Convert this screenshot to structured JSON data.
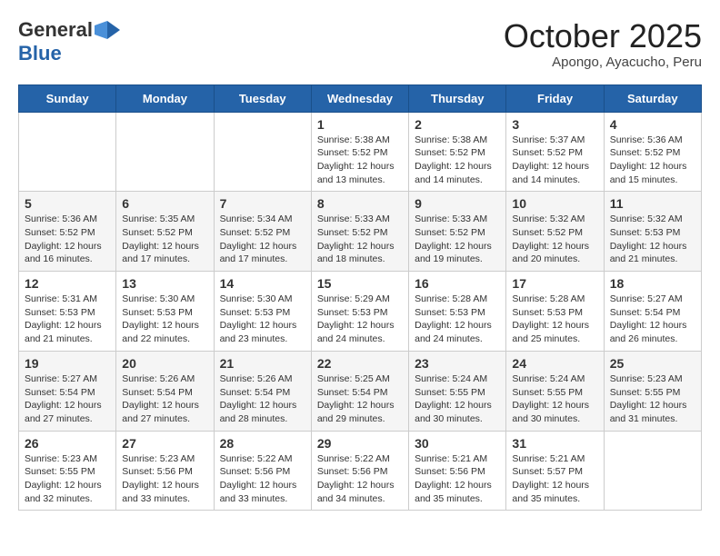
{
  "header": {
    "logo_general": "General",
    "logo_blue": "Blue",
    "month_title": "October 2025",
    "location": "Apongo, Ayacucho, Peru"
  },
  "weekdays": [
    "Sunday",
    "Monday",
    "Tuesday",
    "Wednesday",
    "Thursday",
    "Friday",
    "Saturday"
  ],
  "weeks": [
    [
      {
        "day": "",
        "info": ""
      },
      {
        "day": "",
        "info": ""
      },
      {
        "day": "",
        "info": ""
      },
      {
        "day": "1",
        "info": "Sunrise: 5:38 AM\nSunset: 5:52 PM\nDaylight: 12 hours\nand 13 minutes."
      },
      {
        "day": "2",
        "info": "Sunrise: 5:38 AM\nSunset: 5:52 PM\nDaylight: 12 hours\nand 14 minutes."
      },
      {
        "day": "3",
        "info": "Sunrise: 5:37 AM\nSunset: 5:52 PM\nDaylight: 12 hours\nand 14 minutes."
      },
      {
        "day": "4",
        "info": "Sunrise: 5:36 AM\nSunset: 5:52 PM\nDaylight: 12 hours\nand 15 minutes."
      }
    ],
    [
      {
        "day": "5",
        "info": "Sunrise: 5:36 AM\nSunset: 5:52 PM\nDaylight: 12 hours\nand 16 minutes."
      },
      {
        "day": "6",
        "info": "Sunrise: 5:35 AM\nSunset: 5:52 PM\nDaylight: 12 hours\nand 17 minutes."
      },
      {
        "day": "7",
        "info": "Sunrise: 5:34 AM\nSunset: 5:52 PM\nDaylight: 12 hours\nand 17 minutes."
      },
      {
        "day": "8",
        "info": "Sunrise: 5:33 AM\nSunset: 5:52 PM\nDaylight: 12 hours\nand 18 minutes."
      },
      {
        "day": "9",
        "info": "Sunrise: 5:33 AM\nSunset: 5:52 PM\nDaylight: 12 hours\nand 19 minutes."
      },
      {
        "day": "10",
        "info": "Sunrise: 5:32 AM\nSunset: 5:52 PM\nDaylight: 12 hours\nand 20 minutes."
      },
      {
        "day": "11",
        "info": "Sunrise: 5:32 AM\nSunset: 5:53 PM\nDaylight: 12 hours\nand 21 minutes."
      }
    ],
    [
      {
        "day": "12",
        "info": "Sunrise: 5:31 AM\nSunset: 5:53 PM\nDaylight: 12 hours\nand 21 minutes."
      },
      {
        "day": "13",
        "info": "Sunrise: 5:30 AM\nSunset: 5:53 PM\nDaylight: 12 hours\nand 22 minutes."
      },
      {
        "day": "14",
        "info": "Sunrise: 5:30 AM\nSunset: 5:53 PM\nDaylight: 12 hours\nand 23 minutes."
      },
      {
        "day": "15",
        "info": "Sunrise: 5:29 AM\nSunset: 5:53 PM\nDaylight: 12 hours\nand 24 minutes."
      },
      {
        "day": "16",
        "info": "Sunrise: 5:28 AM\nSunset: 5:53 PM\nDaylight: 12 hours\nand 24 minutes."
      },
      {
        "day": "17",
        "info": "Sunrise: 5:28 AM\nSunset: 5:53 PM\nDaylight: 12 hours\nand 25 minutes."
      },
      {
        "day": "18",
        "info": "Sunrise: 5:27 AM\nSunset: 5:54 PM\nDaylight: 12 hours\nand 26 minutes."
      }
    ],
    [
      {
        "day": "19",
        "info": "Sunrise: 5:27 AM\nSunset: 5:54 PM\nDaylight: 12 hours\nand 27 minutes."
      },
      {
        "day": "20",
        "info": "Sunrise: 5:26 AM\nSunset: 5:54 PM\nDaylight: 12 hours\nand 27 minutes."
      },
      {
        "day": "21",
        "info": "Sunrise: 5:26 AM\nSunset: 5:54 PM\nDaylight: 12 hours\nand 28 minutes."
      },
      {
        "day": "22",
        "info": "Sunrise: 5:25 AM\nSunset: 5:54 PM\nDaylight: 12 hours\nand 29 minutes."
      },
      {
        "day": "23",
        "info": "Sunrise: 5:24 AM\nSunset: 5:55 PM\nDaylight: 12 hours\nand 30 minutes."
      },
      {
        "day": "24",
        "info": "Sunrise: 5:24 AM\nSunset: 5:55 PM\nDaylight: 12 hours\nand 30 minutes."
      },
      {
        "day": "25",
        "info": "Sunrise: 5:23 AM\nSunset: 5:55 PM\nDaylight: 12 hours\nand 31 minutes."
      }
    ],
    [
      {
        "day": "26",
        "info": "Sunrise: 5:23 AM\nSunset: 5:55 PM\nDaylight: 12 hours\nand 32 minutes."
      },
      {
        "day": "27",
        "info": "Sunrise: 5:23 AM\nSunset: 5:56 PM\nDaylight: 12 hours\nand 33 minutes."
      },
      {
        "day": "28",
        "info": "Sunrise: 5:22 AM\nSunset: 5:56 PM\nDaylight: 12 hours\nand 33 minutes."
      },
      {
        "day": "29",
        "info": "Sunrise: 5:22 AM\nSunset: 5:56 PM\nDaylight: 12 hours\nand 34 minutes."
      },
      {
        "day": "30",
        "info": "Sunrise: 5:21 AM\nSunset: 5:56 PM\nDaylight: 12 hours\nand 35 minutes."
      },
      {
        "day": "31",
        "info": "Sunrise: 5:21 AM\nSunset: 5:57 PM\nDaylight: 12 hours\nand 35 minutes."
      },
      {
        "day": "",
        "info": ""
      }
    ]
  ]
}
